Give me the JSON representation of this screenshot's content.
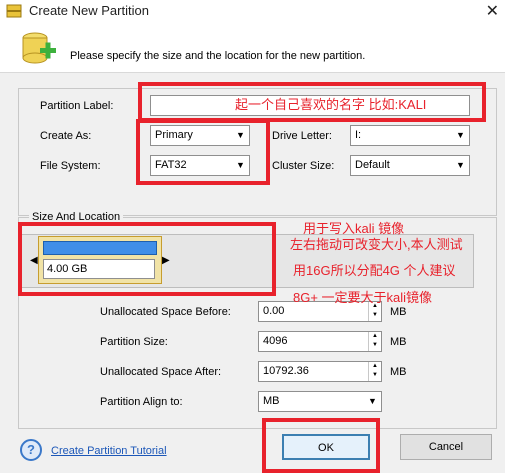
{
  "window": {
    "title": "Create New Partition",
    "close_glyph": "✕"
  },
  "header": {
    "description": "Please specify the size and the location for the new partition."
  },
  "form": {
    "partition_label": {
      "label": "Partition Label:",
      "value": ""
    },
    "create_as": {
      "label": "Create As:",
      "value": "Primary"
    },
    "file_system": {
      "label": "File System:",
      "value": "FAT32"
    },
    "drive_letter": {
      "label": "Drive Letter:",
      "value": "I:"
    },
    "cluster_size": {
      "label": "Cluster Size:",
      "value": "Default"
    }
  },
  "size_location": {
    "legend": "Size And Location",
    "partition_size_text": "4.00 GB",
    "unallocated_before": {
      "label": "Unallocated Space Before:",
      "value": "0.00",
      "unit": "MB"
    },
    "partition_size": {
      "label": "Partition Size:",
      "value": "4096",
      "unit": "MB"
    },
    "unallocated_after": {
      "label": "Unallocated Space After:",
      "value": "10792.36",
      "unit": "MB"
    },
    "align_to": {
      "label": "Partition Align to:",
      "value": "MB"
    }
  },
  "annotations": {
    "label_hint": "起一个自己喜欢的名字 比如:KALI",
    "size_hint_1": "用于写入kali 镜像",
    "size_hint_2": "左右拖动可改变大小,本人测试",
    "size_hint_3": "用16G所以分配4G 个人建议",
    "size_hint_4": "8G+ 一定要大于kali镜像"
  },
  "footer": {
    "tutorial_link": "Create Partition Tutorial",
    "ok": "OK",
    "cancel": "Cancel"
  },
  "colors": {
    "annotation_red": "#e8222c",
    "partition_bar": "#3f8ee8",
    "partition_fill": "#f1e3a6"
  },
  "icons": [
    "app-partition-icon",
    "disk-add-icon",
    "help-icon",
    "dropdown-arrow-icon",
    "spin-arrows-icon"
  ]
}
